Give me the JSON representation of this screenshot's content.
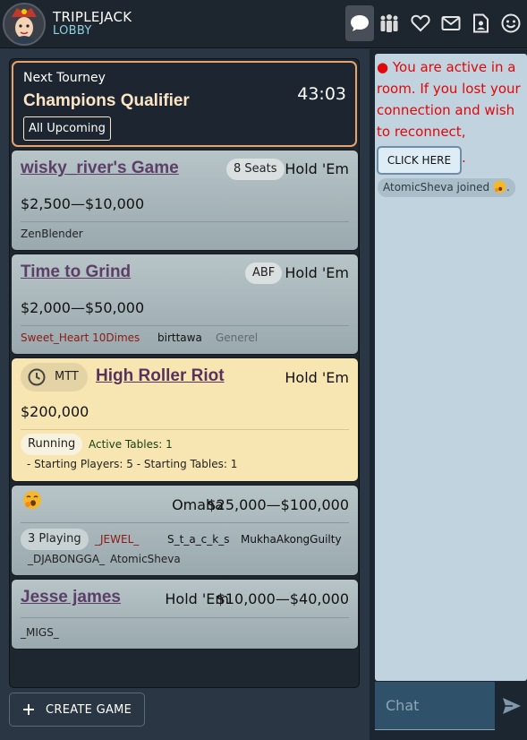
{
  "header": {
    "title": "TRIPLEJACK",
    "subtitle": "LOBBY",
    "nav_icons": [
      "chat-icon",
      "players-icon",
      "heart-icon",
      "mail-icon",
      "contact-icon",
      "smiley-icon"
    ]
  },
  "tourney": {
    "label": "Next Tourney",
    "name": "Champions Qualifier",
    "timer": "43:03",
    "upcoming_label": "All Upcoming"
  },
  "games": [
    {
      "title": "wisky_river's Game",
      "badge": "8 Seats",
      "game": "Hold 'Em",
      "stakes": "$2,500—$10,000",
      "players": [
        "ZenBlender"
      ]
    },
    {
      "title": "Time to Grind",
      "badge": "ABF",
      "game": "Hold 'Em",
      "stakes": "$2,000—$50,000",
      "players": [
        "Sweet_Heart 10Dimes",
        "birttawa",
        "Generel"
      ]
    },
    {
      "badge": "MTT",
      "title": "High Roller Riot",
      "game": "Hold 'Em",
      "stakes": "$200,000",
      "status": "Running",
      "active_tables": "Active Tables: 1",
      "details": "- Starting Players: 5 - Starting Tables: 1"
    },
    {
      "game": "Omaha",
      "stakes": "$25,000—$100,000",
      "playing": "3 Playing",
      "players": [
        "_JEWEL_",
        "S_t_a_c_k_s",
        "MukhaAkongGuilty",
        "_DJABONGGA_",
        "AtomicSheva"
      ]
    },
    {
      "title": "Jesse james",
      "game": "Hold 'Em",
      "stakes": "$10,000—$40,000",
      "players": [
        "_MIGS_"
      ]
    }
  ],
  "create_game_label": "CREATE GAME",
  "chat": {
    "notice": "● You are active in a room. If you lost your connection and wish to reconnect,",
    "click_here": "CLICK HERE",
    "period": ".",
    "joined": "AtomicSheva joined",
    "placeholder": "Chat"
  },
  "colors": {
    "accent_orange": "#e8a36c",
    "card_bg": "#b7c4c8",
    "featured_bg": "#f8e6b2",
    "title_purple": "#5b3f66",
    "alert_red": "#e0080b",
    "chat_bg": "#c0d3de"
  }
}
